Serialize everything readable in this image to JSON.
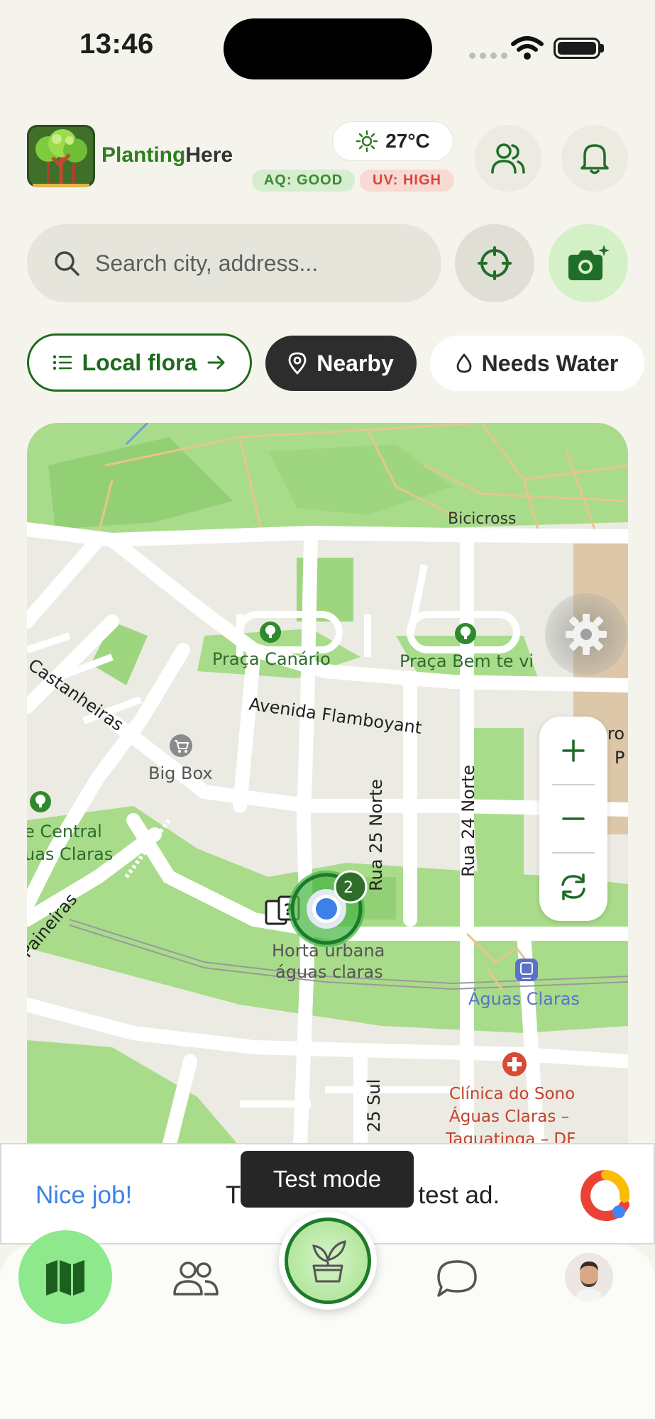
{
  "status_bar": {
    "time": "13:46"
  },
  "header": {
    "brand_part1": "Planting",
    "brand_part2": "Here",
    "weather": {
      "temperature": "27°C",
      "icon": "sun-icon"
    },
    "air_quality": "AQ: GOOD",
    "uv_index": "UV: HIGH"
  },
  "search": {
    "placeholder": "Search city, address..."
  },
  "filters": [
    {
      "label": "Local flora",
      "icon": "list-icon",
      "trailing_icon": "arrow-right-icon"
    },
    {
      "label": "Nearby",
      "icon": "location-pin-icon",
      "selected": true
    },
    {
      "label": "Needs Water",
      "icon": "water-drop-icon"
    }
  ],
  "map": {
    "labels": {
      "bicicross": "Bicicross",
      "praca_canario": "Praça Canário",
      "praca_bem_te_vi": "Praça Bem te vi",
      "castanheiras": "Castanheiras",
      "avenida_flamboyant": "Avenida Flamboyant",
      "big_box": "Big Box",
      "rua_25_norte": "Rua 25 Norte",
      "rua_24_norte": "Rua 24 Norte",
      "central_line1": "e Central",
      "central_line2": "uas Claras",
      "paineiras": "Paineiras",
      "horta_line1": "Horta urbana",
      "horta_line2": "águas claras",
      "aguas_claras": "Águas Claras",
      "clinica_line1": "Clínica do Sono",
      "clinica_line2": "Águas Claras –",
      "clinica_line3": "Taguatinga – DF",
      "rua_25_sul": "25 Sul",
      "right_edge_ro": "ro",
      "right_edge_p": "P"
    },
    "cluster_count": "2"
  },
  "ad": {
    "title": "Nice job!",
    "text_left": "T",
    "text_right": "test ad.",
    "toast": "Test mode"
  },
  "colors": {
    "brand_green": "#2f7d1f",
    "accent_dark_green": "#1d6a1d",
    "aq_good": "#3a8a37",
    "uv_high": "#d8463a",
    "ad_title_blue": "#3d82e6"
  }
}
